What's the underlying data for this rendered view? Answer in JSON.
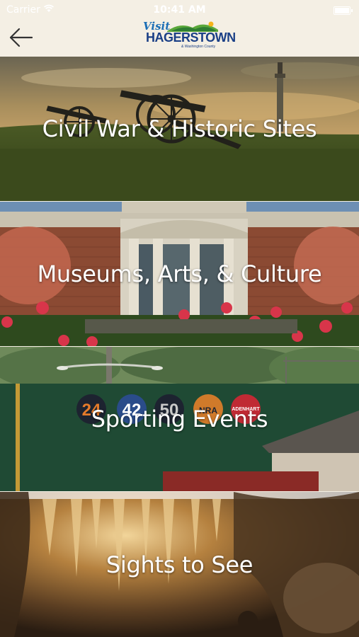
{
  "status_bar": {
    "carrier": "Carrier",
    "time": "10:41 AM"
  },
  "nav": {
    "logo_visit": "Visit",
    "logo_name": "HAGERSTOWN",
    "logo_sub": "& Washington County"
  },
  "categories": [
    {
      "label": "Civil War & Historic Sites"
    },
    {
      "label": "Museums, Arts, & Culture"
    },
    {
      "label": "Sporting Events"
    },
    {
      "label": "Sights to See"
    }
  ],
  "jersey_numbers": [
    "24",
    "42",
    "50",
    "NRA",
    "ADENHART"
  ],
  "colors": {
    "nav_bg": "#f4efe4",
    "logo_blue": "#1a3f86",
    "logo_green": "#5aa83a",
    "label_text": "#ffffff"
  }
}
